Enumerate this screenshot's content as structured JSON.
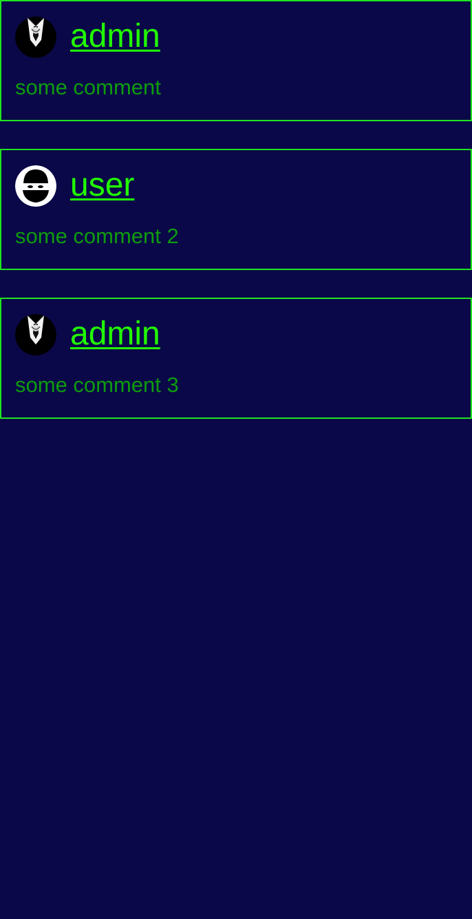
{
  "colors": {
    "background": "#0a0848",
    "border": "#1ee61e",
    "author_link": "#22ff00",
    "comment_text": "#0e9c0e"
  },
  "comments": [
    {
      "author": "admin",
      "avatar_icon": "suit-avatar-icon",
      "text": "some comment"
    },
    {
      "author": "user",
      "avatar_icon": "masked-ninja-avatar-icon",
      "text": "some comment 2"
    },
    {
      "author": "admin",
      "avatar_icon": "suit-avatar-icon",
      "text": "some comment 3"
    }
  ]
}
